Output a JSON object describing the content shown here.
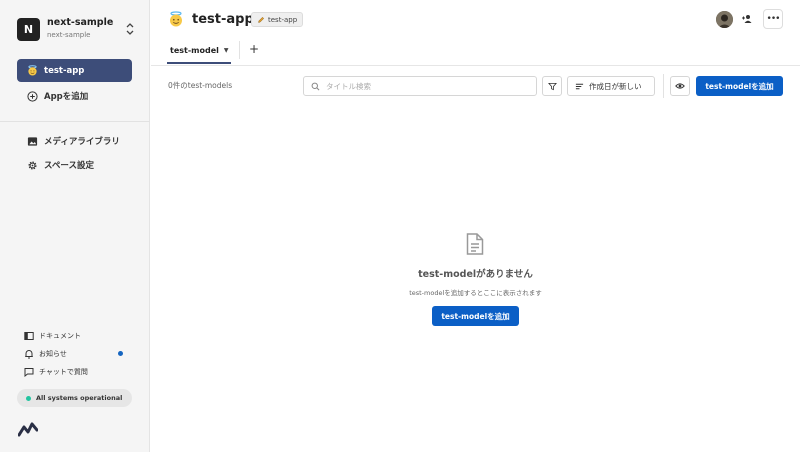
{
  "sidebar": {
    "space": {
      "initial": "N",
      "name": "next-sample",
      "subtitle": "next-sample"
    },
    "apps": [
      {
        "label": "test-app",
        "icon": "smiling-face-with-halo-icon",
        "active": true
      }
    ],
    "add_app": {
      "label": "Appを追加",
      "icon": "plus-circle-icon"
    },
    "nav": [
      {
        "label": "メディアライブラリ",
        "icon": "image-icon"
      },
      {
        "label": "スペース設定",
        "icon": "gear-icon"
      }
    ],
    "footer": [
      {
        "label": "ドキュメント",
        "icon": "book-icon"
      },
      {
        "label": "お知らせ",
        "icon": "bell-icon",
        "unread": true
      },
      {
        "label": "チャットで質問",
        "icon": "chat-icon"
      }
    ],
    "status": {
      "label": "All systems operational",
      "color": "#23c4a0"
    }
  },
  "header": {
    "app_title": "test-app",
    "app_tag": "test-app"
  },
  "tabs": [
    {
      "label": "test-model",
      "active": true
    }
  ],
  "toolbar": {
    "count_text": "0件のtest-models",
    "search_placeholder": "タイトル検索",
    "sort_label": "作成日が新しい",
    "add_label": "test-modelを追加"
  },
  "empty_state": {
    "title": "test-modelがありません",
    "description": "test-modelを追加するとここに表示されます",
    "button_label": "test-modelを追加"
  },
  "colors": {
    "accent": "#3d4d79",
    "primary": "#0b5fc6",
    "notification": "#1565c0"
  }
}
